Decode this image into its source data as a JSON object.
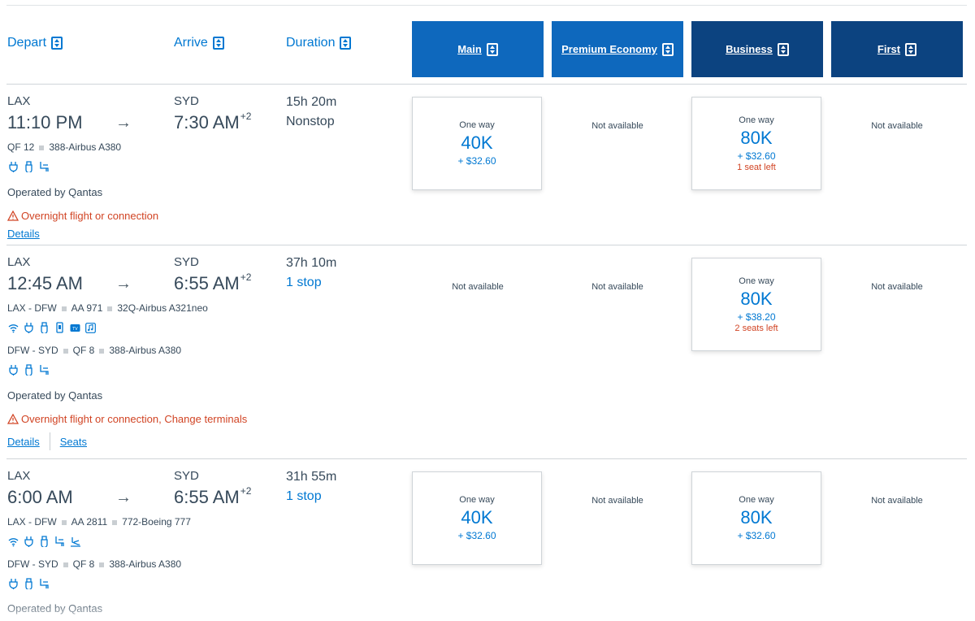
{
  "columns": {
    "depart": "Depart",
    "arrive": "Arrive",
    "duration": "Duration",
    "cabins": [
      "Main",
      "Premium Economy",
      "Business",
      "First"
    ]
  },
  "flights": [
    {
      "origin": "LAX",
      "depart_time": "11:10 PM",
      "destination": "SYD",
      "arrive_time": "7:30 AM",
      "day_offset": "+2",
      "duration": "15h 20m",
      "stops": "Nonstop",
      "segments": [
        {
          "route": "",
          "flight": "QF 12",
          "aircraft": "388-Airbus A380",
          "amenities": [
            "power-icon",
            "usb-icon",
            "seat-icon"
          ]
        }
      ],
      "operated_by": "Operated by Qantas",
      "warning": "Overnight flight or connection",
      "links": [
        "Details"
      ],
      "fares": [
        {
          "label": "One way",
          "points": "40K",
          "tax": "+ $32.60",
          "seats": ""
        },
        {
          "na": "Not available"
        },
        {
          "label": "One way",
          "points": "80K",
          "tax": "+ $32.60",
          "seats": "1 seat left"
        },
        {
          "na": "Not available"
        }
      ]
    },
    {
      "origin": "LAX",
      "depart_time": "12:45 AM",
      "destination": "SYD",
      "arrive_time": "6:55 AM",
      "day_offset": "+2",
      "duration": "37h 10m",
      "stops": "1 stop",
      "segments": [
        {
          "route": "LAX - DFW",
          "flight": "AA 971",
          "aircraft": "32Q-Airbus A321neo",
          "amenities": [
            "wifi-icon",
            "power-icon",
            "usb-icon",
            "phone-icon",
            "tv-icon",
            "music-icon"
          ]
        },
        {
          "route": "DFW - SYD",
          "flight": "QF 8",
          "aircraft": "388-Airbus A380",
          "amenities": [
            "power-icon",
            "usb-icon",
            "seat-icon"
          ]
        }
      ],
      "operated_by": "Operated by Qantas",
      "warning": "Overnight flight or connection, Change terminals",
      "links": [
        "Details",
        "Seats"
      ],
      "fares": [
        {
          "na": "Not available"
        },
        {
          "na": "Not available"
        },
        {
          "label": "One way",
          "points": "80K",
          "tax": "+ $38.20",
          "seats": "2 seats left"
        },
        {
          "na": "Not available"
        }
      ]
    },
    {
      "origin": "LAX",
      "depart_time": "6:00 AM",
      "destination": "SYD",
      "arrive_time": "6:55 AM",
      "day_offset": "+2",
      "duration": "31h 55m",
      "stops": "1 stop",
      "segments": [
        {
          "route": "LAX - DFW",
          "flight": "AA 2811",
          "aircraft": "772-Boeing 777",
          "amenities": [
            "wifi-icon",
            "power-icon",
            "usb-icon",
            "seat-icon",
            "flatbed-icon"
          ]
        },
        {
          "route": "DFW - SYD",
          "flight": "QF 8",
          "aircraft": "388-Airbus A380",
          "amenities": [
            "power-icon",
            "usb-icon",
            "seat-icon"
          ]
        }
      ],
      "operated_by": "Operated by Qantas",
      "warning": "",
      "links": [],
      "fares": [
        {
          "label": "One way",
          "points": "40K",
          "tax": "+ $32.60",
          "seats": ""
        },
        {
          "na": "Not available"
        },
        {
          "label": "One way",
          "points": "80K",
          "tax": "+ $32.60",
          "seats": ""
        },
        {
          "na": "Not available"
        }
      ]
    }
  ],
  "colors": {
    "link": "#0078d2",
    "main_header": "#0e68bd",
    "premium_header": "#0c4380",
    "warning": "#d14424"
  }
}
